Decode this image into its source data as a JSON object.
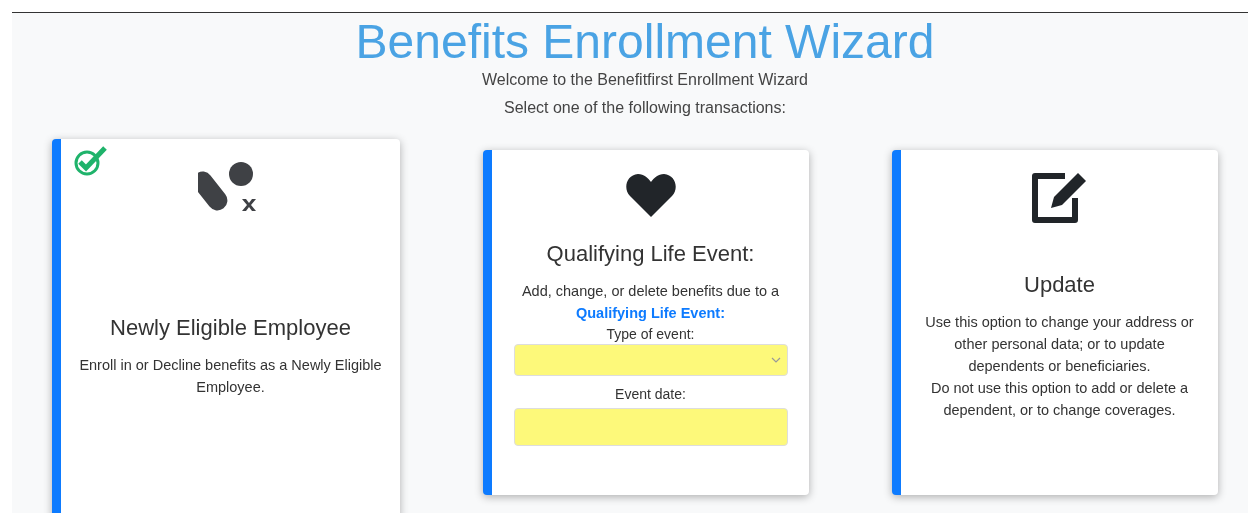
{
  "title": "Benefits Enrollment Wizard",
  "intro": [
    "Welcome to the Benefitfirst Enrollment Wizard",
    "Select one of the following transactions:"
  ],
  "options": [
    {
      "kind": "newly-eligible",
      "selected": true,
      "title": "Newly Eligible Employee",
      "description": [
        "Enroll in or Decline benefits as a Newly Eligible Employee."
      ]
    },
    {
      "kind": "life-event",
      "selected": false,
      "title": "Qualifying Life Event:",
      "description": [
        "Add, change, or delete benefits due to a **Qualifying Life Event:**"
      ],
      "fields": [
        {
          "kind": "select",
          "label": "Type of event:",
          "highlighted": true
        },
        {
          "kind": "text",
          "label": "Event date:",
          "highlighted": true
        }
      ]
    },
    {
      "kind": "update",
      "selected": false,
      "title": "Update",
      "description": [
        "Use this option to change your address or other personal data; or to update dependents or beneficiaries.",
        "Do not use this option to add or delete a dependent, or to change coverages."
      ]
    }
  ]
}
